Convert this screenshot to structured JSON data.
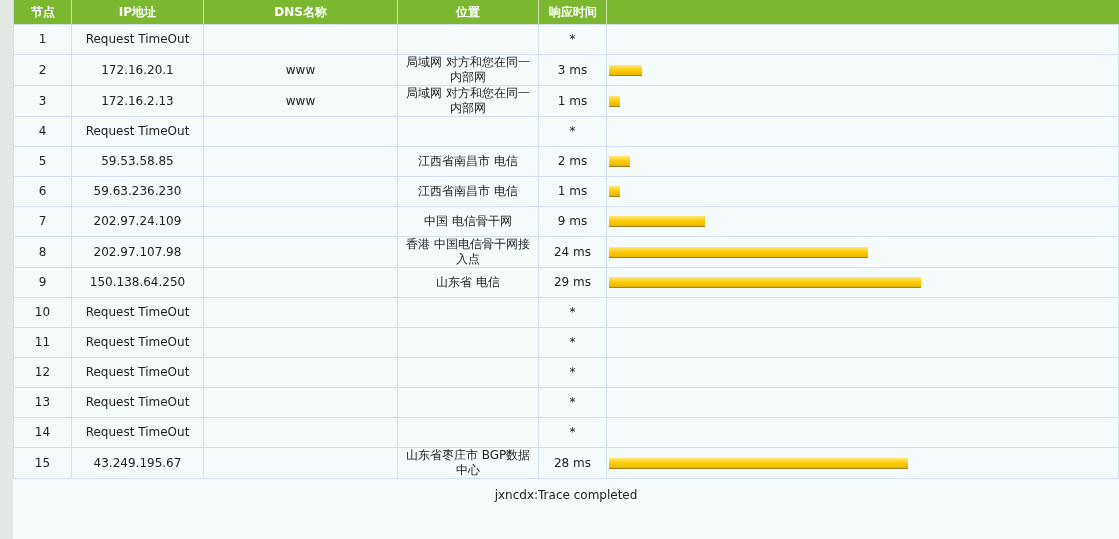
{
  "table": {
    "columns": [
      "节点",
      "IP地址",
      "DNS名称",
      "位置",
      "响应时间"
    ],
    "rows": [
      {
        "hop": "1",
        "ip": "Request TimeOut",
        "time": "*"
      },
      {
        "hop": "2",
        "ip": "172.16.20.1",
        "dns": "www",
        "location": "局域网 对方和您在同一内部网",
        "time": "3 ms",
        "level": 0.065
      },
      {
        "hop": "3",
        "ip": "172.16.2.13",
        "dns": "www",
        "location": "局域网 对方和您在同一内部网",
        "time": "1 ms",
        "level": 0.022
      },
      {
        "hop": "4",
        "ip": "Request TimeOut",
        "time": "*"
      },
      {
        "hop": "5",
        "ip": "59.53.58.85",
        "location": "江西省南昌市 电信",
        "time": "2 ms",
        "level": 0.041
      },
      {
        "hop": "6",
        "ip": "59.63.236.230",
        "location": "江西省南昌市 电信",
        "time": "1 ms",
        "level": 0.022
      },
      {
        "hop": "7",
        "ip": "202.97.24.109",
        "location": "中国 电信骨干网",
        "time": "9 ms",
        "level": 0.19
      },
      {
        "hop": "8",
        "ip": "202.97.107.98",
        "location": "香港 中国电信骨干网接入点",
        "time": "24 ms",
        "level": 0.51
      },
      {
        "hop": "9",
        "ip": "150.138.64.250",
        "location": "山东省 电信",
        "time": "29 ms",
        "level": 0.615
      },
      {
        "hop": "10",
        "ip": "Request TimeOut",
        "time": "*"
      },
      {
        "hop": "11",
        "ip": "Request TimeOut",
        "time": "*"
      },
      {
        "hop": "12",
        "ip": "Request TimeOut",
        "time": "*"
      },
      {
        "hop": "13",
        "ip": "Request TimeOut",
        "time": "*"
      },
      {
        "hop": "14",
        "ip": "Request TimeOut",
        "time": "*"
      },
      {
        "hop": "15",
        "ip": "43.249.195.67",
        "location": "山东省枣庄市 BGP数据中心",
        "time": "28 ms",
        "level": 0.59
      }
    ],
    "footer": "jxncdx:Trace completed"
  }
}
